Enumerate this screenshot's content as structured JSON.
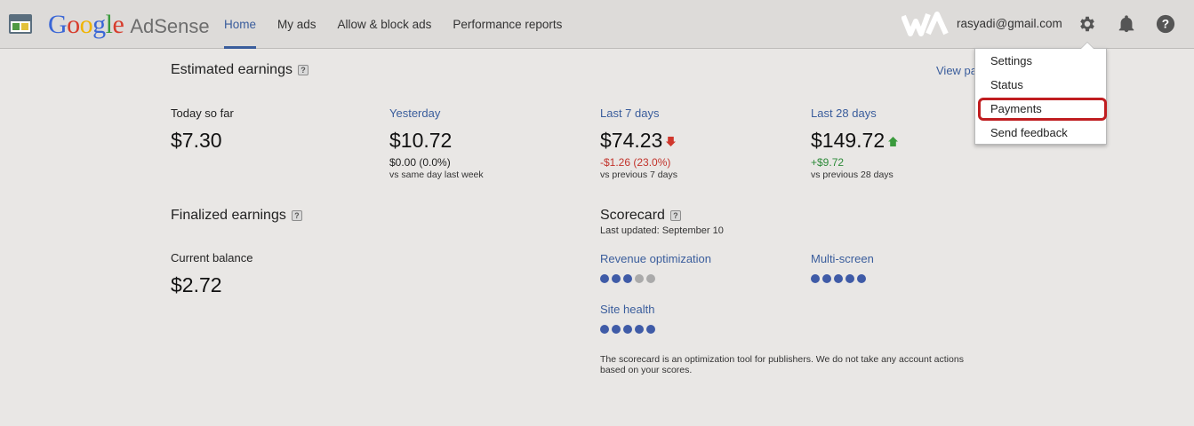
{
  "header": {
    "logo_google": "Google",
    "logo_adsense": "AdSense",
    "nav": [
      {
        "label": "Home",
        "active": true
      },
      {
        "label": "My ads",
        "active": false
      },
      {
        "label": "Allow & block ads",
        "active": false
      },
      {
        "label": "Performance reports",
        "active": false
      }
    ],
    "user_email": "rasyadi@gmail.com"
  },
  "dropdown": {
    "items": [
      "Settings",
      "Status",
      "Payments",
      "Send feedback"
    ],
    "highlighted": "Payments"
  },
  "estimated": {
    "title": "Estimated earnings",
    "view_link": "View pa",
    "today": {
      "label": "Today so far",
      "value": "$7.30"
    },
    "yesterday": {
      "label": "Yesterday",
      "value": "$10.72",
      "delta": "$0.00 (0.0%)",
      "compare": "vs same day last week"
    },
    "last7": {
      "label": "Last 7 days",
      "value": "$74.23",
      "delta": "-$1.26 (23.0%)",
      "compare": "vs previous 7 days",
      "trend": "down"
    },
    "last28": {
      "label": "Last 28 days",
      "value": "$149.72",
      "delta": "+$9.72",
      "compare": "vs previous 28 days",
      "trend": "up"
    }
  },
  "finalized": {
    "title": "Finalized earnings",
    "balance_label": "Current balance",
    "balance_value": "$2.72"
  },
  "scorecard": {
    "title": "Scorecard",
    "updated": "Last updated: September 10",
    "revenue": {
      "label": "Revenue optimization",
      "score": 3,
      "max": 5
    },
    "multiscreen": {
      "label": "Multi-screen",
      "score": 5,
      "max": 5
    },
    "site_health": {
      "label": "Site health",
      "score": 5,
      "max": 5
    },
    "note": "The scorecard is an optimization tool for publishers. We do not take any account actions based on your scores."
  },
  "colors": {
    "accent": "#3a5d9c",
    "down": "#c2332b",
    "up": "#2e8b3a",
    "highlight": "#c01d20"
  }
}
